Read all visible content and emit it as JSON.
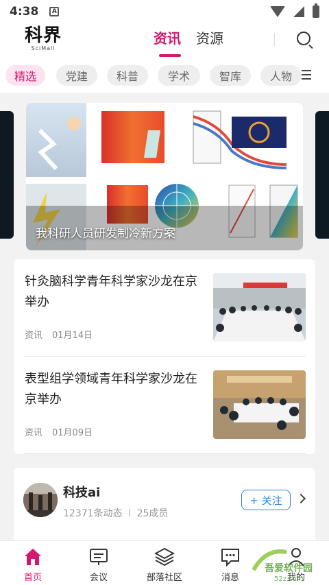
{
  "status_bar": {
    "time": "4:38",
    "notification_icon": "A"
  },
  "header": {
    "logo_cn": "科界",
    "logo_en": "SciMall",
    "tabs": [
      {
        "label": "资讯",
        "active": true
      },
      {
        "label": "资源",
        "active": false
      }
    ],
    "search_icon": "search-icon"
  },
  "categories": [
    {
      "label": "精选",
      "active": true
    },
    {
      "label": "党建",
      "active": false
    },
    {
      "label": "科普",
      "active": false
    },
    {
      "label": "学术",
      "active": false
    },
    {
      "label": "智库",
      "active": false
    },
    {
      "label": "人物",
      "active": false
    }
  ],
  "banner": {
    "caption": "我科研人员研发制冷新方案"
  },
  "news": [
    {
      "title": "针灸脑科学青年科学家沙龙在京举办",
      "tag": "资讯",
      "date": "01月14日"
    },
    {
      "title": "表型组学领域青年科学家沙龙在京举办",
      "tag": "资讯",
      "date": "01月09日"
    }
  ],
  "tribe": {
    "name": "科技ai",
    "posts": "12371条动态",
    "separator": "I",
    "members": "25成员",
    "follow_label": "+ 关注"
  },
  "bottom_nav": [
    {
      "label": "首页",
      "icon": "home-icon",
      "active": true
    },
    {
      "label": "会议",
      "icon": "meeting-icon",
      "active": false
    },
    {
      "label": "部落社区",
      "icon": "layers-icon",
      "active": false
    },
    {
      "label": "消息",
      "icon": "message-icon",
      "active": false
    },
    {
      "label": "我的",
      "icon": "user-icon",
      "active": false
    }
  ],
  "watermark": {
    "brand": "吾爱软件园",
    "url": "52z.com"
  },
  "colors": {
    "accent": "#d6186c",
    "follow_blue": "#2f7de1",
    "background": "#f2f2f2"
  }
}
